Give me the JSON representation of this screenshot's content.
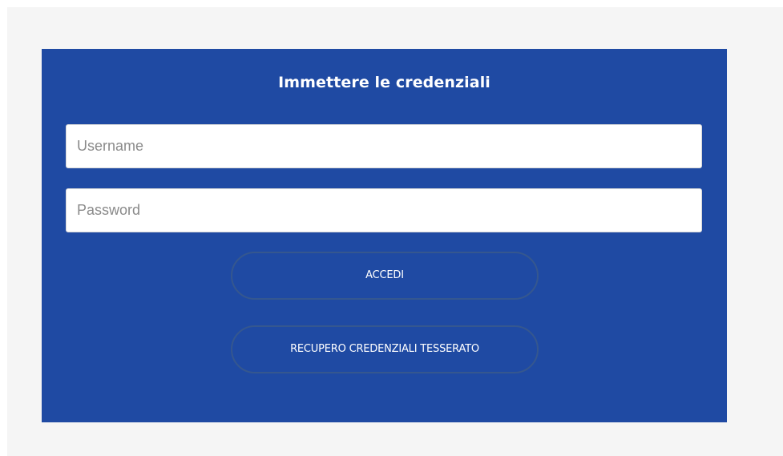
{
  "login": {
    "title": "Immettere le credenziali",
    "username_placeholder": "Username",
    "username_value": "",
    "password_placeholder": "Password",
    "password_value": "",
    "login_button_label": "ACCEDI",
    "recover_button_label": "RECUPERO CREDENZIALI TESSERATO"
  },
  "colors": {
    "panel_background": "#1f4aa3",
    "page_background": "#f5f5f5",
    "button_border": "#35578f",
    "text_on_panel": "#ffffff"
  }
}
